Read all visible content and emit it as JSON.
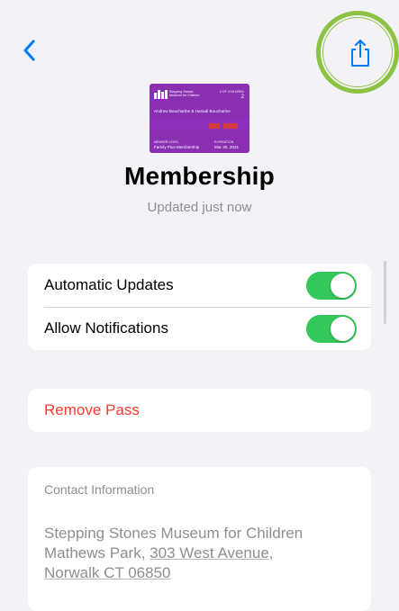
{
  "nav": {
    "back_icon": "chevron-left-icon",
    "share_icon": "share-icon",
    "accent": "#007aff",
    "highlight_ring": "#8cc342"
  },
  "pass_card": {
    "background": "#8a2fb2",
    "org_line1": "Stepping Stones",
    "org_line2": "Museum for Children",
    "count_label": "# OF CHILDREN",
    "count_value": "2",
    "member_names": "Andrew Boucharlne & Hanadi Boucharlne",
    "level_label": "MEMBER LEVEL",
    "level_value": "Family Plus Membership",
    "expiration_label": "EXPIRATION",
    "expiration_value": "Mar 30, 2021"
  },
  "header": {
    "title": "Membership",
    "subtitle": "Updated just now"
  },
  "settings": {
    "rows": [
      {
        "label": "Automatic Updates",
        "on": true
      },
      {
        "label": "Allow Notifications",
        "on": true
      }
    ],
    "toggle_color": "#34c759"
  },
  "remove": {
    "label": "Remove Pass",
    "color": "#ff3b30"
  },
  "contact": {
    "heading": "Contact Information",
    "line1": "Stepping Stones Museum for Children",
    "line2_prefix": "Mathews Park, ",
    "line2_link": "303 West Avenue,",
    "line3": "Norwalk CT 06850"
  }
}
